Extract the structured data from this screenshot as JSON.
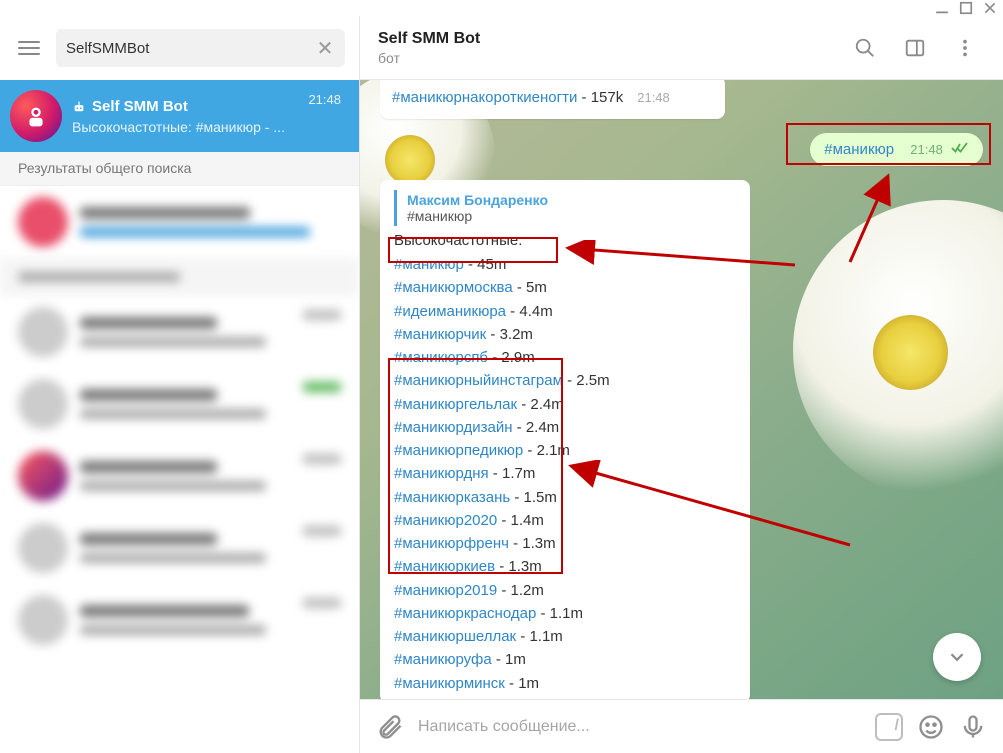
{
  "search": {
    "value": "SelfSMMBot"
  },
  "active_chat": {
    "title": "Self SMM Bot",
    "subtitle": "Высокочастотные: #маникюр - ...",
    "time": "21:48"
  },
  "search_section_label": "Результаты общего поиска",
  "header": {
    "title": "Self SMM Bot",
    "status": "бот"
  },
  "top_message": {
    "tag": "#маникюрнакороткиеногти",
    "count": " - 157k",
    "time": "21:48"
  },
  "out_message": {
    "tag": "#маникюр",
    "time": "21:48"
  },
  "bot_reply": {
    "quote_name": "Максим Бондаренко",
    "quote_text": "#маникюр",
    "section_label": "Высокочастотные:",
    "tags": [
      {
        "tag": "#маникюр",
        "count": " - 45m"
      },
      {
        "tag": "#маникюрмосква",
        "count": " - 5m"
      },
      {
        "tag": "#идеиманикюра",
        "count": " - 4.4m"
      },
      {
        "tag": "#маникюрчик",
        "count": " - 3.2m"
      },
      {
        "tag": "#маникюрспб",
        "count": " - 2.9m"
      },
      {
        "tag": "#маникюрныйинстаграм",
        "count": " - 2.5m"
      },
      {
        "tag": "#маникюргельлак",
        "count": " - 2.4m"
      },
      {
        "tag": "#маникюрдизайн",
        "count": " - 2.4m"
      },
      {
        "tag": "#маникюрпедикюр",
        "count": " - 2.1m"
      },
      {
        "tag": "#маникюрдня",
        "count": " - 1.7m"
      },
      {
        "tag": "#маникюрказань",
        "count": " - 1.5m"
      },
      {
        "tag": "#маникюр2020",
        "count": " - 1.4m"
      },
      {
        "tag": "#маникюрфренч",
        "count": " - 1.3m"
      },
      {
        "tag": "#маникюркиев",
        "count": " - 1.3m"
      },
      {
        "tag": "#маникюр2019",
        "count": " - 1.2m"
      },
      {
        "tag": "#маникюркраснодар",
        "count": " - 1.1m"
      },
      {
        "tag": "#маникюршеллак",
        "count": " - 1.1m"
      },
      {
        "tag": "#маникюруфа",
        "count": " - 1m"
      },
      {
        "tag": "#маникюрминск",
        "count": " - 1m"
      }
    ]
  },
  "compose": {
    "placeholder": "Написать сообщение..."
  }
}
